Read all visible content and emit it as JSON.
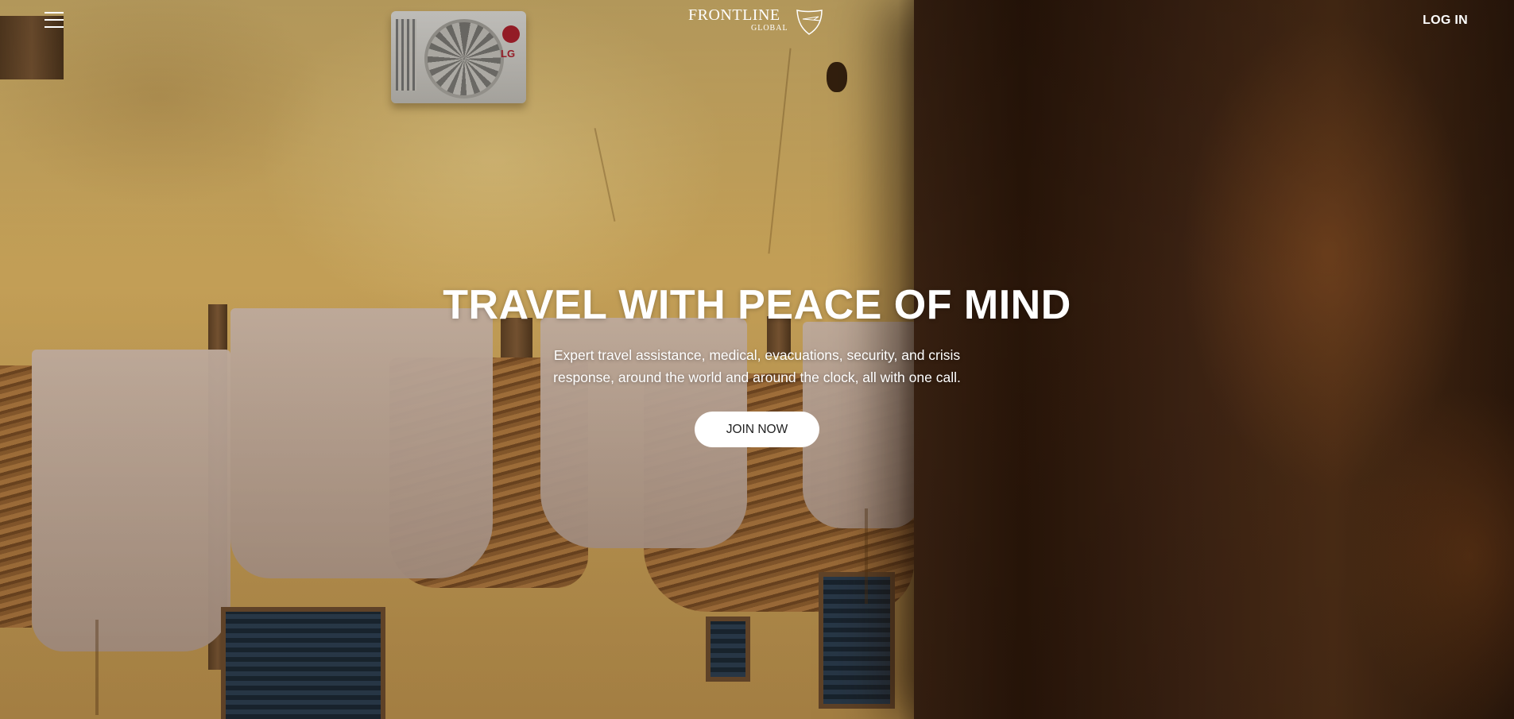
{
  "header": {
    "menu_icon": "hamburger-menu-icon",
    "brand_name": "FRONTLINE",
    "brand_sub": "GLOBAL",
    "brand_icon": "shield-plane-icon",
    "login_label": "LOG IN"
  },
  "hero": {
    "headline": "TRAVEL WITH PEACE OF MIND",
    "subtext": "Expert travel assistance, medical, evacuations, security, and crisis response, around the world and around the clock, all with one call.",
    "cta_label": "JOIN NOW",
    "background_scene": "leather hides drying on a wall",
    "ac_brand": "LG"
  },
  "colors": {
    "cta_background": "#ffffff",
    "cta_text": "#222222",
    "text": "#ffffff"
  }
}
